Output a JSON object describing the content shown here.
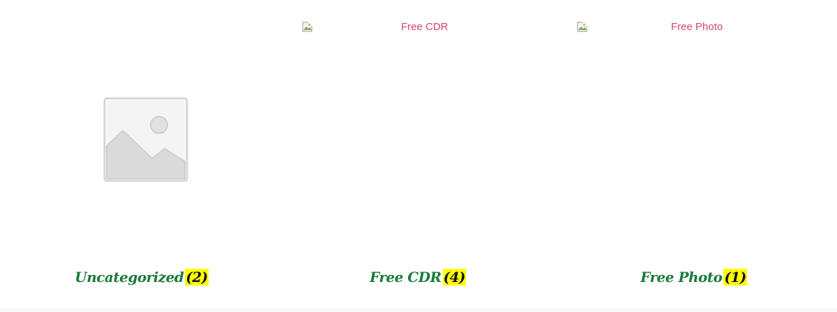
{
  "categories": [
    {
      "name": "Uncategorized",
      "count": "(2)",
      "image": "placeholder-icon",
      "image_alt": ""
    },
    {
      "name": "Free CDR",
      "count": "(4)",
      "image": "broken-image-icon",
      "image_alt": "Free CDR"
    },
    {
      "name": "Free Photo",
      "count": "(1)",
      "image": "broken-image-icon",
      "image_alt": "Free Photo"
    }
  ],
  "colors": {
    "title": "#1a7a3c",
    "count_highlight": "#ffff00",
    "alt_text": "#d8436e",
    "placeholder_gray": "#d6d6d6"
  }
}
